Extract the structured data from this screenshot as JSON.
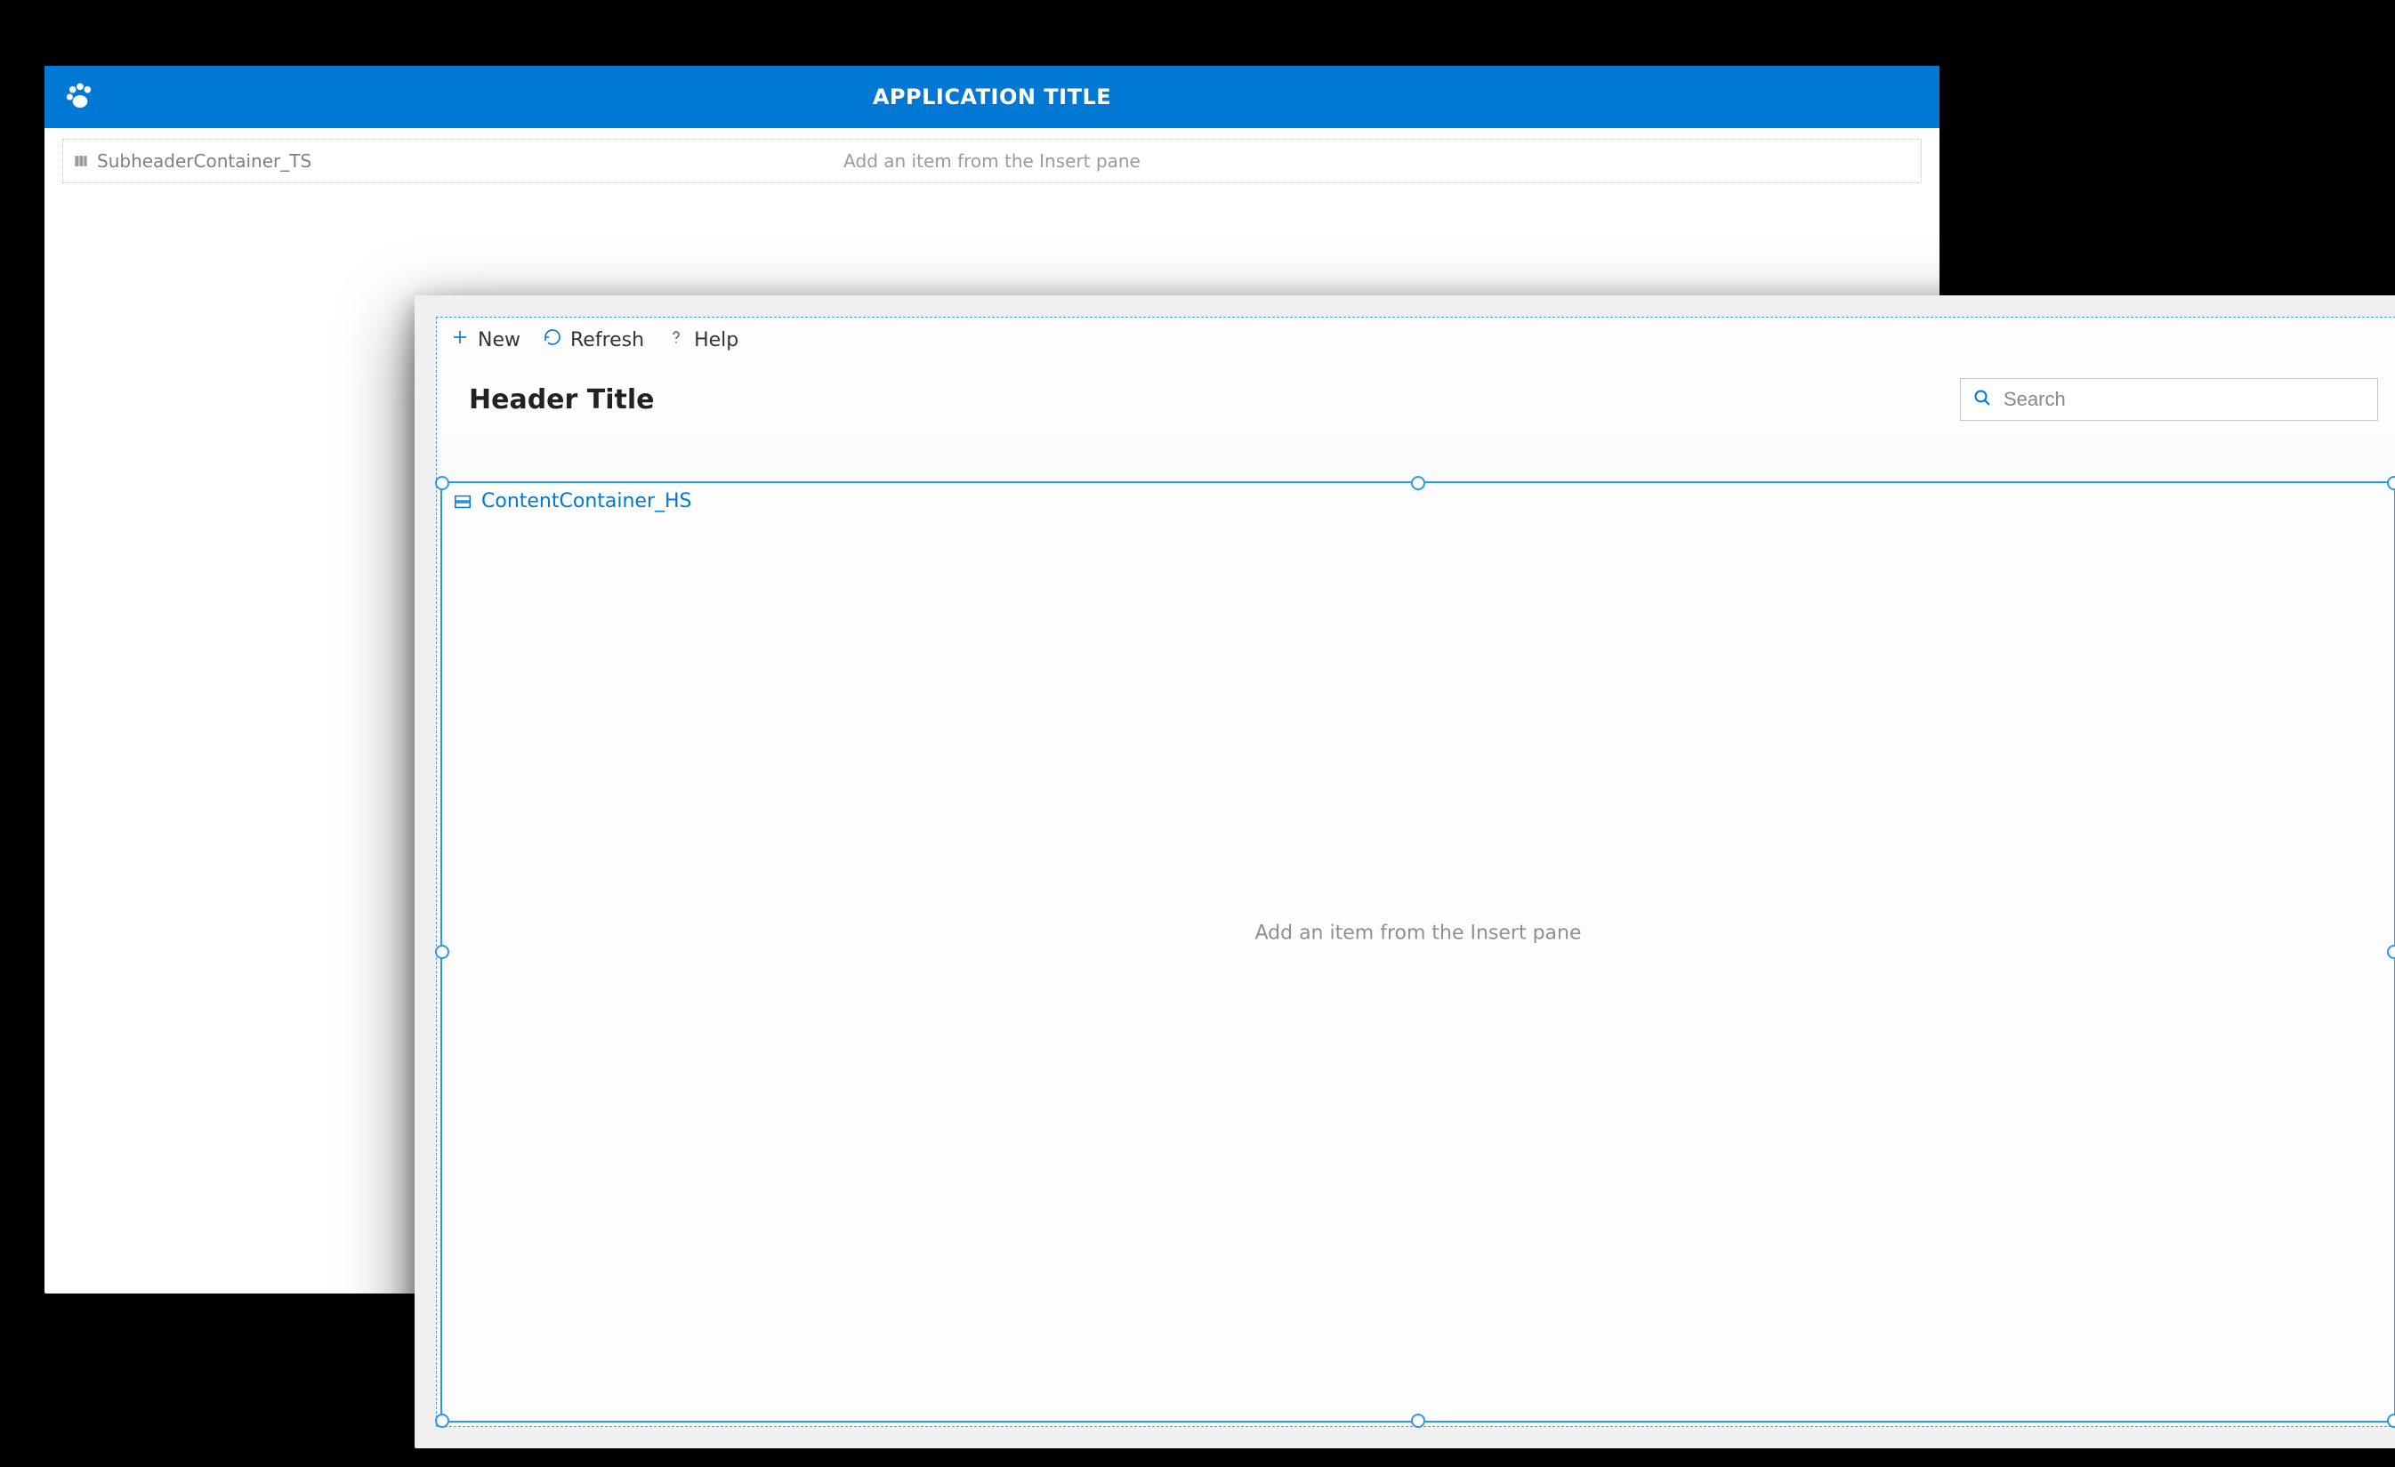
{
  "backWindow": {
    "title": "APPLICATION TITLE",
    "subheader": {
      "name": "SubheaderContainer_TS",
      "placeholder": "Add an item from the Insert pane"
    }
  },
  "frontWindow": {
    "commandbar": {
      "new": "New",
      "refresh": "Refresh",
      "help": "Help"
    },
    "headerTitle": "Header Title",
    "search": {
      "placeholder": "Search"
    },
    "content": {
      "name": "ContentContainer_HS",
      "placeholder": "Add an item from the Insert pane"
    }
  }
}
